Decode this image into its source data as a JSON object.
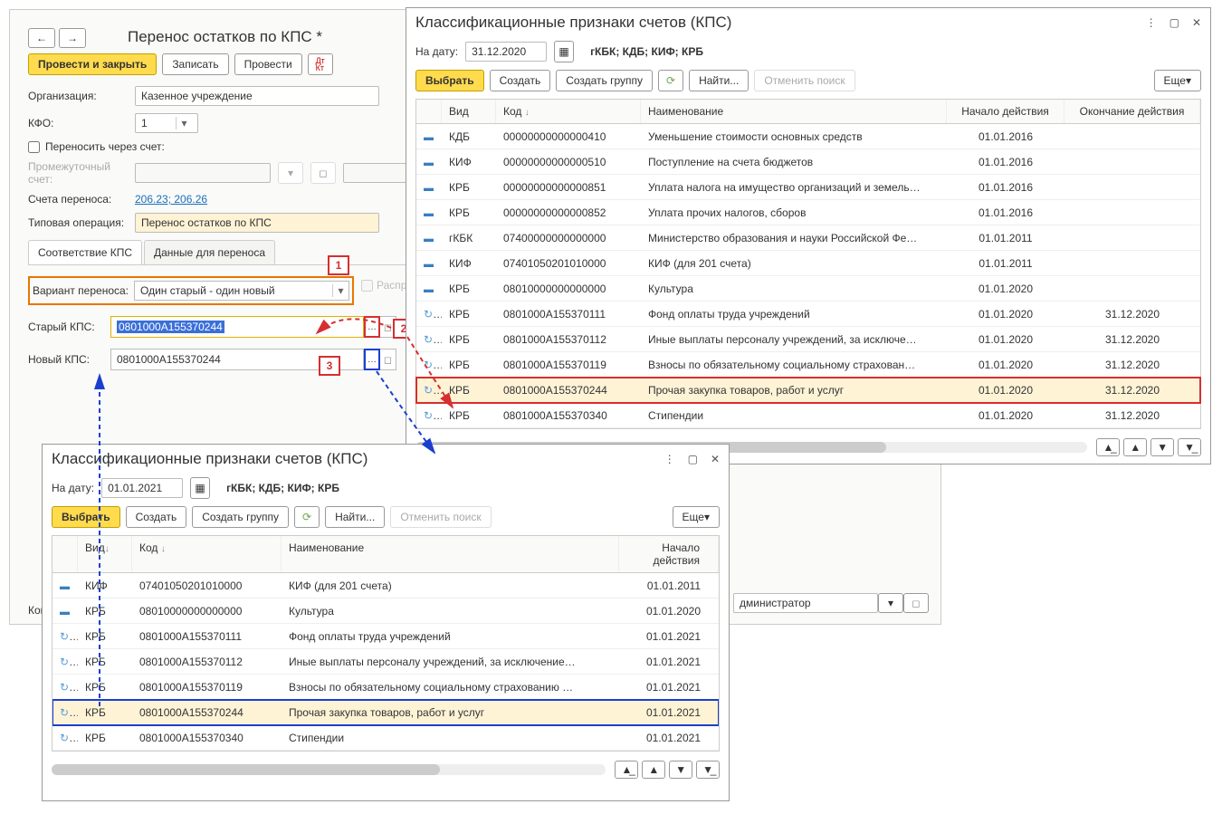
{
  "backPanel": {
    "title": "Перенос остатков по КПС *",
    "toolbar": {
      "processClose": "Провести и закрыть",
      "write": "Записать",
      "process": "Провести"
    },
    "form": {
      "orgLabel": "Организация:",
      "orgValue": "Казенное учреждение",
      "kfoLabel": "КФО:",
      "kfoValue": "1",
      "transferThrough": "Переносить через счет:",
      "interLabel": "Промежуточный счет:",
      "accountsLabel": "Счета переноса:",
      "accountsValue": "206.23; 206.26",
      "typicalLabel": "Типовая операция:",
      "typicalValue": "Перенос остатков по КПС"
    },
    "tabs": {
      "tab1": "Соответствие КПС",
      "tab2": "Данные для переноса"
    },
    "variant": {
      "label": "Вариант переноса:",
      "value": "Один старый - один новый",
      "distribute": "Распредел..."
    },
    "oldKps": {
      "label": "Старый КПС:",
      "value": "0801000А155370244"
    },
    "newKps": {
      "label": "Новый КПС:",
      "value": "0801000А155370244"
    },
    "callouts": {
      "c1": "1",
      "c2": "2",
      "c3": "3"
    },
    "footer": {
      "komLabel": "Ком",
      "adminValue": "дминистратор"
    }
  },
  "dialogR": {
    "title": "Классификационные признаки счетов (КПС)",
    "dateLabel": "На дату:",
    "dateValue": "31.12.2020",
    "filterText": "гКБК; КДБ; КИФ; КРБ",
    "buttons": {
      "select": "Выбрать",
      "create": "Создать",
      "createGroup": "Создать группу",
      "find": "Найти...",
      "cancelFind": "Отменить поиск",
      "more": "Еще"
    },
    "headers": {
      "vid": "Вид",
      "kod": "Код",
      "naim": "Наименование",
      "start": "Начало действия",
      "end": "Окончание действия"
    },
    "rows": [
      {
        "vid": "КДБ",
        "kod": "00000000000000410",
        "naim": "Уменьшение стоимости основных средств",
        "start": "01.01.2016",
        "end": ""
      },
      {
        "vid": "КИФ",
        "kod": "00000000000000510",
        "naim": "Поступление на счета бюджетов",
        "start": "01.01.2016",
        "end": ""
      },
      {
        "vid": "КРБ",
        "kod": "00000000000000851",
        "naim": "Уплата налога на имущество организаций и земель…",
        "start": "01.01.2016",
        "end": ""
      },
      {
        "vid": "КРБ",
        "kod": "00000000000000852",
        "naim": "Уплата прочих налогов, сборов",
        "start": "01.01.2016",
        "end": ""
      },
      {
        "vid": "гКБК",
        "kod": "07400000000000000",
        "naim": "Министерство образования и науки Российской Фе…",
        "start": "01.01.2011",
        "end": ""
      },
      {
        "vid": "КИФ",
        "kod": "07401050201010000",
        "naim": "КИФ (для 201 счета)",
        "start": "01.01.2011",
        "end": ""
      },
      {
        "vid": "КРБ",
        "kod": "08010000000000000",
        "naim": "Культура",
        "start": "01.01.2020",
        "end": ""
      },
      {
        "vid": "КРБ",
        "kod": "0801000А155370111",
        "naim": "Фонд оплаты труда учреждений",
        "start": "01.01.2020",
        "end": "31.12.2020",
        "ref": true
      },
      {
        "vid": "КРБ",
        "kod": "0801000А155370112",
        "naim": "Иные выплаты персоналу учреждений, за исключе…",
        "start": "01.01.2020",
        "end": "31.12.2020",
        "ref": true
      },
      {
        "vid": "КРБ",
        "kod": "0801000А155370119",
        "naim": "Взносы по обязательному социальному страхован…",
        "start": "01.01.2020",
        "end": "31.12.2020",
        "ref": true
      },
      {
        "vid": "КРБ",
        "kod": "0801000А155370244",
        "naim": "Прочая закупка товаров, работ и услуг",
        "start": "01.01.2020",
        "end": "31.12.2020",
        "hl": "red",
        "ref": true
      },
      {
        "vid": "КРБ",
        "kod": "0801000А155370340",
        "naim": "Стипендии",
        "start": "01.01.2020",
        "end": "31.12.2020",
        "ref": true
      }
    ]
  },
  "dialogB": {
    "title": "Классификационные признаки счетов (КПС)",
    "dateLabel": "На дату:",
    "dateValue": "01.01.2021",
    "filterText": "гКБК; КДБ; КИФ; КРБ",
    "buttons": {
      "select": "Выбрать",
      "create": "Создать",
      "createGroup": "Создать группу",
      "find": "Найти...",
      "cancelFind": "Отменить поиск",
      "more": "Еще"
    },
    "headers": {
      "vid": "Вид",
      "kod": "Код",
      "naim": "Наименование",
      "start": "Начало действия"
    },
    "rows": [
      {
        "vid": "КИФ",
        "kod": "07401050201010000",
        "naim": "КИФ (для 201 счета)",
        "start": "01.01.2011"
      },
      {
        "vid": "КРБ",
        "kod": "08010000000000000",
        "naim": "Культура",
        "start": "01.01.2020"
      },
      {
        "vid": "КРБ",
        "kod": "0801000А155370111",
        "naim": "Фонд оплаты труда учреждений",
        "start": "01.01.2021",
        "ref": true
      },
      {
        "vid": "КРБ",
        "kod": "0801000А155370112",
        "naim": "Иные выплаты персоналу учреждений, за исключение…",
        "start": "01.01.2021",
        "ref": true
      },
      {
        "vid": "КРБ",
        "kod": "0801000А155370119",
        "naim": "Взносы по обязательному социальному страхованию …",
        "start": "01.01.2021",
        "ref": true
      },
      {
        "vid": "КРБ",
        "kod": "0801000А155370244",
        "naim": "Прочая закупка товаров, работ и услуг",
        "start": "01.01.2021",
        "hl": "blue",
        "ref": true
      },
      {
        "vid": "КРБ",
        "kod": "0801000А155370340",
        "naim": "Стипендии",
        "start": "01.01.2021",
        "ref": true
      }
    ]
  }
}
